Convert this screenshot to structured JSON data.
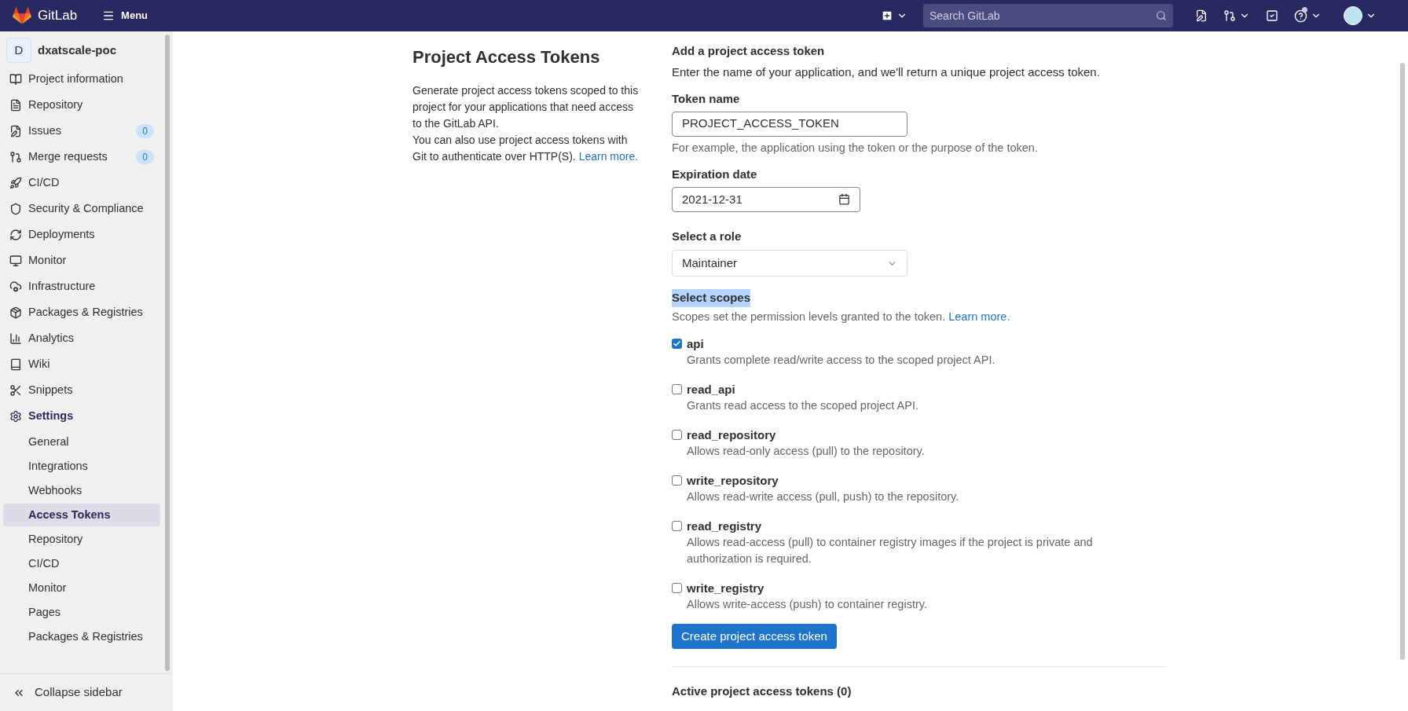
{
  "top_bar": {
    "brand": "GitLab",
    "menu_label": "Menu",
    "search": {
      "placeholder": "Search GitLab"
    },
    "help_notification": true
  },
  "sidebar": {
    "project": {
      "initial": "D",
      "name": "dxatscale-poc"
    },
    "items": [
      {
        "label": "Project information",
        "active": false
      },
      {
        "label": "Repository",
        "active": false
      },
      {
        "label": "Issues",
        "active": false,
        "count": "0"
      },
      {
        "label": "Merge requests",
        "active": false,
        "count": "0"
      },
      {
        "label": "CI/CD",
        "active": false
      },
      {
        "label": "Security & Compliance",
        "active": false
      },
      {
        "label": "Deployments",
        "active": false
      },
      {
        "label": "Monitor",
        "active": false
      },
      {
        "label": "Infrastructure",
        "active": false
      },
      {
        "label": "Packages & Registries",
        "active": false
      },
      {
        "label": "Analytics",
        "active": false
      },
      {
        "label": "Wiki",
        "active": false
      },
      {
        "label": "Snippets",
        "active": false
      },
      {
        "label": "Settings",
        "active": true,
        "children": [
          {
            "label": "General",
            "selected": false
          },
          {
            "label": "Integrations",
            "selected": false
          },
          {
            "label": "Webhooks",
            "selected": false
          },
          {
            "label": "Access Tokens",
            "selected": true
          },
          {
            "label": "Repository",
            "selected": false
          },
          {
            "label": "CI/CD",
            "selected": false
          },
          {
            "label": "Monitor",
            "selected": false
          },
          {
            "label": "Pages",
            "selected": false
          },
          {
            "label": "Packages & Registries",
            "selected": false
          }
        ]
      }
    ],
    "collapse_label": "Collapse sidebar"
  },
  "intro": {
    "title": "Project Access Tokens",
    "text": "Generate project access tokens scoped to this project for your applications that need access to the GitLab API.",
    "text2": "You can also use project access tokens with Git to authenticate over HTTP(S).",
    "link": "Learn more."
  },
  "form": {
    "heading": "Add a project access token",
    "description": "Enter the name of your application, and we'll return a unique project access token.",
    "token_name": {
      "label": "Token name",
      "value": "PROJECT_ACCESS_TOKEN",
      "hint": "For example, the application using the token or the purpose of the token."
    },
    "expiration": {
      "label": "Expiration date",
      "value": "2021-12-31"
    },
    "role": {
      "label": "Select a role",
      "value": "Maintainer"
    },
    "scopes": {
      "heading": "Select scopes",
      "heading_highlighted": true,
      "description": "Scopes set the permission levels granted to the token.",
      "link": "Learn more.",
      "items": [
        {
          "name": "api",
          "checked": true,
          "description": "Grants complete read/write access to the scoped project API."
        },
        {
          "name": "read_api",
          "checked": false,
          "description": "Grants read access to the scoped project API."
        },
        {
          "name": "read_repository",
          "checked": false,
          "description": "Allows read-only access (pull) to the repository."
        },
        {
          "name": "write_repository",
          "checked": false,
          "description": "Allows read-write access (pull, push) to the repository."
        },
        {
          "name": "read_registry",
          "checked": false,
          "description": "Allows read-access (pull) to container registry images if the project is private and authorization is required."
        },
        {
          "name": "write_registry",
          "checked": false,
          "description": "Allows write-access (push) to container registry."
        }
      ]
    },
    "submit": "Create project access token"
  },
  "active_tokens": {
    "heading": "Active project access tokens (0)"
  }
}
